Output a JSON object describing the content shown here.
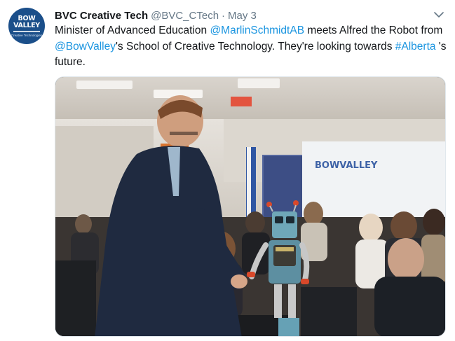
{
  "account": {
    "avatar_lines": [
      "BOW",
      "VALLEY",
      "Creative Technologies"
    ],
    "name": "BVC Creative Tech",
    "handle": "@BVC_CTech",
    "separator": "·",
    "date": "May 3"
  },
  "tweet": {
    "part1": "Minister of Advanced Education ",
    "mention1": "@MarlinSchmidtAB",
    "part2": " meets Alfred the Robot from ",
    "mention2": "@BowValley",
    "part3": "'s School of Creative Technology. They're looking towards ",
    "hashtag": "#Alberta",
    "part4": " 's future."
  },
  "media": {
    "banner_text": "BOWVALLEY"
  },
  "colors": {
    "link": "#1b95e0",
    "secondary_text": "#657786",
    "brand": "#1b4f8a"
  },
  "icons": {
    "caret": "chevron-down-icon"
  }
}
